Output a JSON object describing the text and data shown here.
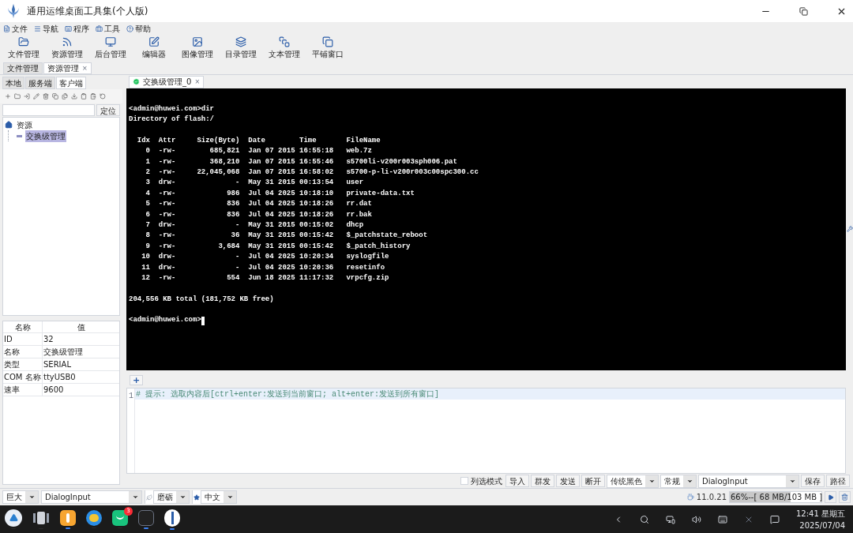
{
  "window": {
    "title": "通用运维桌面工具集(个人版)"
  },
  "menu": [
    {
      "label": "文件"
    },
    {
      "label": "导航"
    },
    {
      "label": "程序"
    },
    {
      "label": "工具"
    },
    {
      "label": "帮助"
    }
  ],
  "toolbar": [
    {
      "label": "文件管理"
    },
    {
      "label": "资源管理"
    },
    {
      "label": "后台管理"
    },
    {
      "label": "编辑器"
    },
    {
      "label": "图像管理"
    },
    {
      "label": "目录管理"
    },
    {
      "label": "文本管理"
    },
    {
      "label": "平铺窗口"
    }
  ],
  "doc_tabs": [
    {
      "label": "文件管理",
      "selected": false
    },
    {
      "label": "资源管理",
      "selected": true,
      "close": "×"
    }
  ],
  "left_tabs": [
    {
      "label": "本地",
      "selected": false
    },
    {
      "label": "服务端",
      "selected": false
    },
    {
      "label": "客户端",
      "selected": true
    }
  ],
  "locate_button": "定位",
  "tree": [
    {
      "label": "资源",
      "selected": false,
      "children": [
        {
          "label": "交换级管理",
          "selected": true
        }
      ]
    }
  ],
  "properties": {
    "columns": [
      "名称",
      "值"
    ],
    "rows": [
      [
        "ID",
        "32"
      ],
      [
        "名称",
        "交换级管理"
      ],
      [
        "类型",
        "SERIAL"
      ],
      [
        "COM 名称",
        "ttyUSB0"
      ],
      [
        "速率",
        "9600"
      ]
    ]
  },
  "session_tab": {
    "label": "交换级管理_0",
    "connected": true,
    "close": "×"
  },
  "terminal": {
    "blocks": [
      [
        "<admin@huwei.com>dir",
        "Directory of flash:/"
      ],
      [
        "  Idx  Attr     Size(Byte)  Date        Time       FileName",
        "    0  -rw-        685,821  Jan 07 2015 16:55:18   web.7z",
        "    1  -rw-        368,210  Jan 07 2015 16:55:46   s5700li-v200r003sph006.pat",
        "    2  -rw-     22,045,068  Jan 07 2015 16:58:02   s5700-p-li-v200r003c00spc300.cc",
        "    3  drw-              -  May 31 2015 00:13:54   user",
        "    4  -rw-            986  Jul 04 2025 10:18:10   private-data.txt",
        "    5  -rw-            836  Jul 04 2025 10:18:26   rr.dat",
        "    6  -rw-            836  Jul 04 2025 10:18:26   rr.bak",
        "    7  drw-              -  May 31 2015 00:15:02   dhcp",
        "    8  -rw-             36  May 31 2015 00:15:42   $_patchstate_reboot",
        "    9  -rw-          3,684  May 31 2015 00:15:42   $_patch_history",
        "   10  drw-              -  Jul 04 2025 10:20:34   syslogfile",
        "   11  drw-              -  Jul 04 2025 10:20:36   resetinfo",
        "   12  -rw-            554  Jun 18 2025 11:17:32   vrpcfg.zip"
      ],
      [
        "204,556 KB total (181,752 KB free)"
      ],
      [
        "<admin@huwei.com>"
      ]
    ]
  },
  "add_button": "+",
  "editor": {
    "line_number": "1",
    "text": "# 提示: 选取内容后[ctrl+enter:发送到当前窗口; alt+enter:发送到所有窗口]"
  },
  "controls": [
    {
      "kind": "checkbox",
      "label": "列选模式",
      "checked": false
    },
    {
      "kind": "button",
      "label": "导入"
    },
    {
      "kind": "button",
      "label": "群发"
    },
    {
      "kind": "button",
      "label": "发送"
    },
    {
      "kind": "button",
      "label": "断开"
    },
    {
      "kind": "select",
      "label": "传统黑色"
    },
    {
      "kind": "select",
      "label": "常规"
    },
    {
      "kind": "wide_select",
      "label": "DialogInput"
    },
    {
      "kind": "button",
      "label": "保存"
    },
    {
      "kind": "button",
      "label": "路径"
    }
  ],
  "status_selects": [
    {
      "kind": "select",
      "label": "巨大"
    },
    {
      "kind": "wide_select",
      "label": "DialogInput"
    },
    {
      "kind": "select",
      "label": "磨砺"
    },
    {
      "kind": "select",
      "label": "中文"
    }
  ],
  "java_version": "11.0.21",
  "memory": {
    "reading": "66%--[ 68 MB/103 MB ]",
    "level": 0.66
  },
  "taskbar": {
    "apps": [
      {
        "running": false
      },
      {
        "running": false
      },
      {
        "running": true
      },
      {
        "running": false
      },
      {
        "running": false,
        "badge": "3"
      },
      {
        "running": true
      },
      {
        "running": true
      }
    ],
    "time": "12:41 星期五",
    "date": "2025/07/04"
  }
}
